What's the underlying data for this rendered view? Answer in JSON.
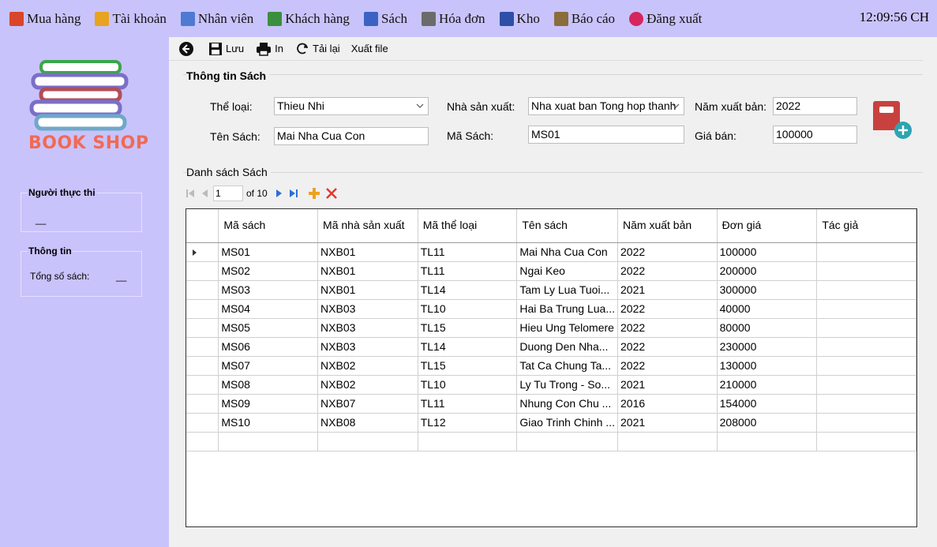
{
  "menu": {
    "items": [
      {
        "label": "Mua hàng",
        "color": "#d9452b"
      },
      {
        "label": "Tài khoản",
        "color": "#e8a420"
      },
      {
        "label": "Nhân viên",
        "color": "#4e7bd1"
      },
      {
        "label": "Khách hàng",
        "color": "#3a8f3e"
      },
      {
        "label": "Sách",
        "color": "#3b63c4"
      },
      {
        "label": "Hóa đơn",
        "color": "#6b6b6b"
      },
      {
        "label": "Kho",
        "color": "#2d4fa8"
      },
      {
        "label": "Báo cáo",
        "color": "#8a6d3b"
      },
      {
        "label": "Đăng xuất",
        "color": "#d6245c"
      }
    ],
    "clock": "12:09:56 CH"
  },
  "sidebar": {
    "logo_text": "BOOK SHOP",
    "executor_title": "Người thực thi",
    "executor_value": "__",
    "info_title": "Thông tin",
    "total_books_label": "Tổng số sách:",
    "total_books_value": "__"
  },
  "toolbar": {
    "save_label": "Lưu",
    "print_label": "In",
    "reload_label": "Tải lại",
    "export_label": "Xuất file"
  },
  "form": {
    "section_title": "Thông tin Sách",
    "genre_label": "Thể loại:",
    "genre_value": "Thieu Nhi",
    "publisher_label": "Nhà sản xuất:",
    "publisher_value": "Nha xuat ban Tong hop thanh",
    "year_label": "Năm xuất bản:",
    "year_value": "2022",
    "name_label": "Tên Sách:",
    "name_value": "Mai Nha Cua Con",
    "code_label": "Mã Sách:",
    "code_value": "MS01",
    "price_label": "Giá bán:",
    "price_value": "100000"
  },
  "list": {
    "section_title": "Danh sách Sách",
    "nav_position": "1",
    "nav_of": "of 10"
  },
  "grid": {
    "columns": [
      "Mã sách",
      "Mã nhà sản xuất",
      "Mã thể loại",
      "Tên sách",
      "Năm xuất bản",
      "Đơn giá",
      "Tác giả"
    ],
    "rows": [
      [
        "MS01",
        "NXB01",
        "TL11",
        "Mai Nha Cua Con",
        "2022",
        "100000",
        ""
      ],
      [
        "MS02",
        "NXB01",
        "TL11",
        "Ngai Keo",
        "2022",
        "200000",
        ""
      ],
      [
        "MS03",
        "NXB01",
        "TL14",
        "Tam Ly Lua Tuoi...",
        "2021",
        "300000",
        ""
      ],
      [
        "MS04",
        "NXB03",
        "TL10",
        "Hai Ba Trung Lua...",
        "2022",
        "40000",
        ""
      ],
      [
        "MS05",
        "NXB03",
        "TL15",
        "Hieu Ung Telomere",
        "2022",
        "80000",
        ""
      ],
      [
        "MS06",
        "NXB03",
        "TL14",
        "Duong Den Nha...",
        "2022",
        "230000",
        ""
      ],
      [
        "MS07",
        "NXB02",
        "TL15",
        "Tat Ca Chung Ta...",
        "2022",
        "130000",
        ""
      ],
      [
        "MS08",
        "NXB02",
        "TL10",
        "Ly Tu Trong - So...",
        "2021",
        "210000",
        ""
      ],
      [
        "MS09",
        "NXB07",
        "TL11",
        "Nhung Con Chu ...",
        "2016",
        "154000",
        ""
      ],
      [
        "MS10",
        "NXB08",
        "TL12",
        "Giao Trinh Chinh ...",
        "2021",
        "208000",
        ""
      ]
    ]
  }
}
